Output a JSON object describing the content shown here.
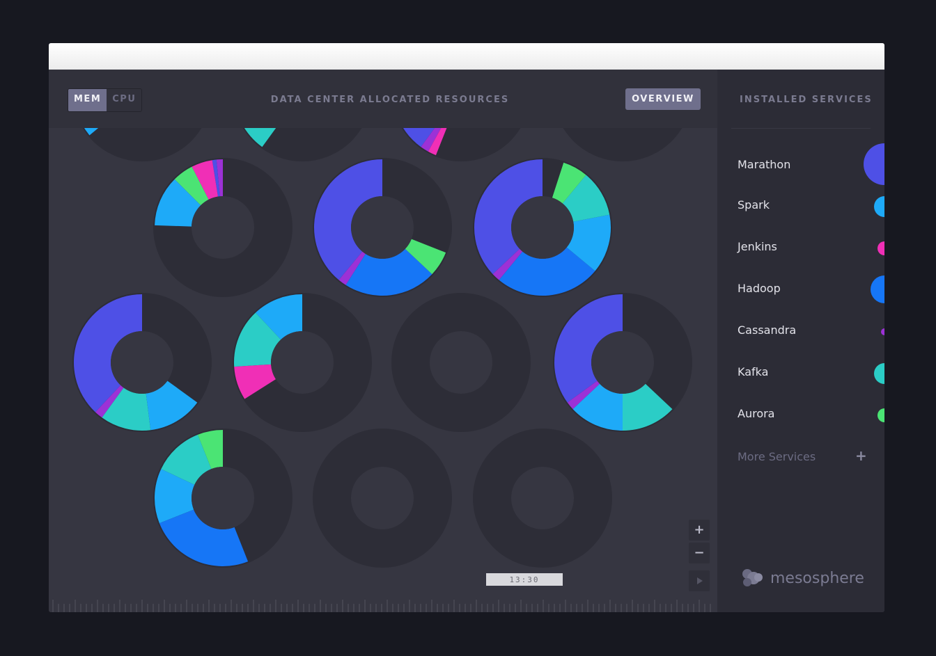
{
  "toggle": {
    "mem": "MEM",
    "cpu": "CPU",
    "active": "MEM"
  },
  "header": {
    "title": "DATA CENTER ALLOCATED RESOURCES",
    "overview": "OVERVIEW"
  },
  "sidebar": {
    "title": "INSTALLED SERVICES",
    "services": [
      {
        "name": "Marathon",
        "color": "#4e50e6"
      },
      {
        "name": "Spark",
        "color": "#1eaaf8"
      },
      {
        "name": "Jenkins",
        "color": "#f02fb6"
      },
      {
        "name": "Hadoop",
        "color": "#1676f6"
      },
      {
        "name": "Cassandra",
        "color": "#9c31d6"
      },
      {
        "name": "Kafka",
        "color": "#2bcdc6"
      },
      {
        "name": "Aurora",
        "color": "#4be474"
      }
    ],
    "more": "More Services",
    "more_icon": "plus-icon"
  },
  "zoom": {
    "in": "+",
    "out": "−",
    "play_icon": "play-icon"
  },
  "timeline": {
    "time": "13:30"
  },
  "brand": {
    "name": "mesosphere",
    "icon": "mesosphere-logo-icon"
  },
  "colors": {
    "background": "#363641",
    "ring_empty": "#2d2d37",
    "ring_outline": "#272732",
    "accent": "#6f6f8c"
  },
  "nodes": [
    {
      "row": 0,
      "col": 0,
      "slices": [
        [
          "Marathon",
          0.04
        ],
        [
          "Cassandra",
          0.01
        ],
        [
          "Jenkins",
          0.06
        ],
        [
          "Aurora",
          0.05
        ],
        [
          "Kafka",
          0.14
        ],
        [
          "Spark",
          0.06
        ]
      ]
    },
    {
      "row": 0,
      "col": 1,
      "slices": [
        [
          "Hadoop",
          0.25
        ],
        [
          "Kafka",
          0.15
        ]
      ]
    },
    {
      "row": 0,
      "col": 2,
      "slices": [
        [
          "Marathon",
          0.4
        ],
        [
          "Cassandra",
          0.02
        ],
        [
          "Jenkins",
          0.02
        ]
      ]
    },
    {
      "row": 0,
      "col": 3,
      "slices": [
        [
          "Hadoop",
          0.25
        ]
      ]
    },
    {
      "row": 1,
      "col": 0,
      "slices": [
        [
          "Cassandra",
          0.015
        ],
        [
          "Marathon",
          0.01
        ],
        [
          "Jenkins",
          0.05
        ],
        [
          "Aurora",
          0.05
        ],
        [
          "Spark",
          0.12
        ]
      ]
    },
    {
      "row": 1,
      "col": 1,
      "slices": [
        [
          "Marathon",
          0.39
        ],
        [
          "Cassandra",
          0.02
        ],
        [
          "Hadoop",
          0.22
        ],
        [
          "Aurora",
          0.06
        ]
      ]
    },
    {
      "row": 1,
      "col": 2,
      "slices": [
        [
          "Marathon",
          0.37
        ],
        [
          "Cassandra",
          0.02
        ],
        [
          "Hadoop",
          0.25
        ],
        [
          "Spark",
          0.14
        ],
        [
          "Kafka",
          0.11
        ],
        [
          "Aurora",
          0.06
        ]
      ]
    },
    {
      "row": 2,
      "col": 0,
      "slices": [
        [
          "Marathon",
          0.38
        ],
        [
          "Cassandra",
          0.02
        ],
        [
          "Kafka",
          0.12
        ],
        [
          "Spark",
          0.13
        ]
      ]
    },
    {
      "row": 2,
      "col": 1,
      "slices": [
        [
          "Spark",
          0.12
        ],
        [
          "Kafka",
          0.14
        ],
        [
          "Jenkins",
          0.08
        ]
      ]
    },
    {
      "row": 2,
      "col": 2,
      "slices": []
    },
    {
      "row": 2,
      "col": 3,
      "slices": [
        [
          "Marathon",
          0.35
        ],
        [
          "Cassandra",
          0.02
        ],
        [
          "Spark",
          0.13
        ],
        [
          "Kafka",
          0.13
        ]
      ]
    },
    {
      "row": 3,
      "col": 0,
      "slices": [
        [
          "Aurora",
          0.06
        ],
        [
          "Kafka",
          0.12
        ],
        [
          "Spark",
          0.13
        ],
        [
          "Hadoop",
          0.25
        ]
      ]
    },
    {
      "row": 3,
      "col": 1,
      "slices": []
    },
    {
      "row": 3,
      "col": 2,
      "slices": []
    }
  ]
}
